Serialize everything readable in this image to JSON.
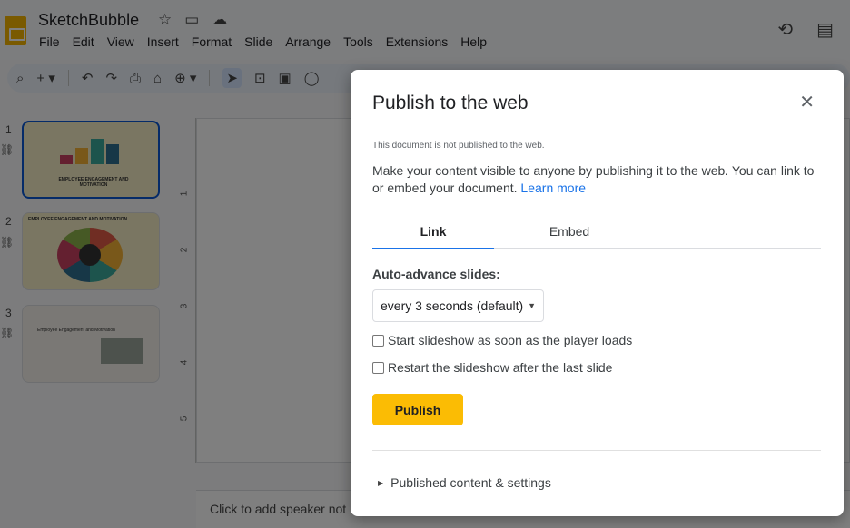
{
  "app": {
    "doc_title": "SketchBubble",
    "menu": [
      "File",
      "Edit",
      "View",
      "Insert",
      "Format",
      "Slide",
      "Arrange",
      "Tools",
      "Extensions",
      "Help"
    ],
    "brand_color": "#f4b400"
  },
  "filmstrip": {
    "slides": [
      {
        "number": "1",
        "title": "EMPLOYEE ENGAGEMENT AND MOTIVATION"
      },
      {
        "number": "2",
        "title": "EMPLOYEE ENGAGEMENT AND MOTIVATION"
      },
      {
        "number": "3",
        "title": "Employee Engagement and Motivation"
      }
    ]
  },
  "ruler": [
    "1",
    "2",
    "3",
    "4",
    "5"
  ],
  "notes": {
    "placeholder": "Click to add speaker not"
  },
  "dialog": {
    "title": "Publish to the web",
    "status": "This document is not published to the web.",
    "description": "Make your content visible to anyone by publishing it to the web. You can link to or embed your document.",
    "learn_more": "Learn more",
    "tabs": {
      "link": "Link",
      "embed": "Embed"
    },
    "auto_advance_label": "Auto-advance slides:",
    "auto_advance_value": "every 3 seconds (default)",
    "checkbox_start": "Start slideshow as soon as the player loads",
    "checkbox_restart": "Restart the slideshow after the last slide",
    "publish_button": "Publish",
    "published_settings": "Published content & settings",
    "accent_color": "#1a73e8",
    "button_color": "#fbbc04"
  }
}
